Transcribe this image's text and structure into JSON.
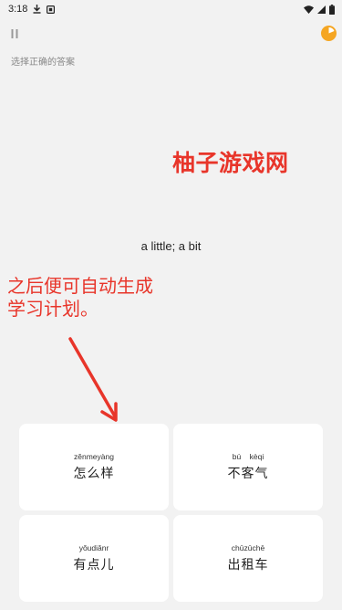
{
  "status_bar": {
    "time": "3:18",
    "left_icons": [
      "download-icon",
      "notification-square-icon"
    ],
    "right_icons": [
      "wifi-icon",
      "cellular-icon",
      "battery-icon"
    ]
  },
  "toolbar": {
    "pause_icon": "pause-icon",
    "timer_icon": "timer-pie-icon",
    "timer_color": "#f5a623"
  },
  "instruction": "选择正确的答案",
  "watermark": "柚子游戏网",
  "question": "a little; a bit",
  "overlay_caption": "之后便可自动生成学习计划。",
  "overlay_color": "#e8352a",
  "options": [
    {
      "pinyin": "zěnmeyàng",
      "hanzi": "怎么样"
    },
    {
      "pinyin": "bú    kèqi",
      "hanzi": "不客气"
    },
    {
      "pinyin": "yǒudiǎnr",
      "hanzi": "有点儿"
    },
    {
      "pinyin": "chūzūchē",
      "hanzi": "出租车"
    }
  ]
}
